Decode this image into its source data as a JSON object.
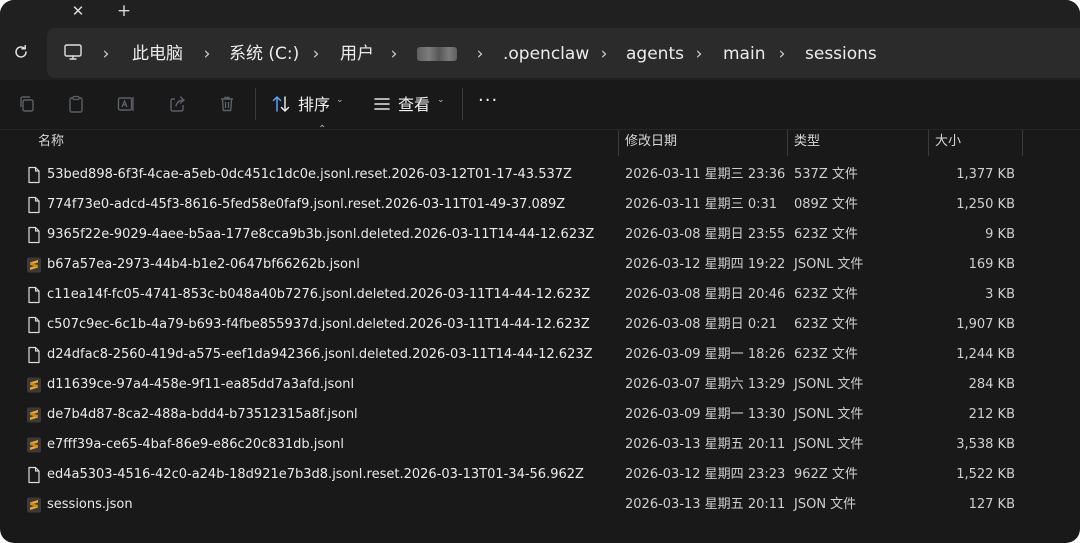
{
  "tabstrip": {
    "close_glyph": "✕",
    "new_glyph": "+"
  },
  "address": {
    "crumbs": [
      "此电脑",
      "系统 (C:)",
      "用户",
      ".openclaw",
      "agents",
      "main",
      "sessions"
    ],
    "separator": "›"
  },
  "toolbar": {
    "sort_label": "排序",
    "view_label": "查看",
    "more_label": "···"
  },
  "columns": {
    "name": "名称",
    "modified": "修改日期",
    "type": "类型",
    "size": "大小"
  },
  "files": [
    {
      "name": "53bed898-6f3f-4cae-a5eb-0dc451c1dc0e.jsonl.reset.2026-03-12T01-17-43.537Z",
      "modified": "2026-03-11 星期三 23:36",
      "type": "537Z 文件",
      "size": "1,377 KB",
      "icon": "file-icon"
    },
    {
      "name": "774f73e0-adcd-45f3-8616-5fed58e0faf9.jsonl.reset.2026-03-11T01-49-37.089Z",
      "modified": "2026-03-11 星期三 0:31",
      "type": "089Z 文件",
      "size": "1,250 KB",
      "icon": "file-icon"
    },
    {
      "name": "9365f22e-9029-4aee-b5aa-177e8cca9b3b.jsonl.deleted.2026-03-11T14-44-12.623Z",
      "modified": "2026-03-08 星期日 23:55",
      "type": "623Z 文件",
      "size": "9 KB",
      "icon": "file-icon"
    },
    {
      "name": "b67a57ea-2973-44b4-b1e2-0647bf66262b.jsonl",
      "modified": "2026-03-12 星期四 19:22",
      "type": "JSONL 文件",
      "size": "169 KB",
      "icon": "sublime-file-icon"
    },
    {
      "name": "c11ea14f-fc05-4741-853c-b048a40b7276.jsonl.deleted.2026-03-11T14-44-12.623Z",
      "modified": "2026-03-08 星期日 20:46",
      "type": "623Z 文件",
      "size": "3 KB",
      "icon": "file-icon"
    },
    {
      "name": "c507c9ec-6c1b-4a79-b693-f4fbe855937d.jsonl.deleted.2026-03-11T14-44-12.623Z",
      "modified": "2026-03-08 星期日 0:21",
      "type": "623Z 文件",
      "size": "1,907 KB",
      "icon": "file-icon"
    },
    {
      "name": "d24dfac8-2560-419d-a575-eef1da942366.jsonl.deleted.2026-03-11T14-44-12.623Z",
      "modified": "2026-03-09 星期一 18:26",
      "type": "623Z 文件",
      "size": "1,244 KB",
      "icon": "file-icon"
    },
    {
      "name": "d11639ce-97a4-458e-9f11-ea85dd7a3afd.jsonl",
      "modified": "2026-03-07 星期六 13:29",
      "type": "JSONL 文件",
      "size": "284 KB",
      "icon": "sublime-file-icon"
    },
    {
      "name": "de7b4d87-8ca2-488a-bdd4-b73512315a8f.jsonl",
      "modified": "2026-03-09 星期一 13:30",
      "type": "JSONL 文件",
      "size": "212 KB",
      "icon": "sublime-file-icon"
    },
    {
      "name": "e7fff39a-ce65-4baf-86e9-e86c20c831db.jsonl",
      "modified": "2026-03-13 星期五 20:11",
      "type": "JSONL 文件",
      "size": "3,538 KB",
      "icon": "sublime-file-icon"
    },
    {
      "name": "ed4a5303-4516-42c0-a24b-18d921e7b3d8.jsonl.reset.2026-03-13T01-34-56.962Z",
      "modified": "2026-03-12 星期四 23:23",
      "type": "962Z 文件",
      "size": "1,522 KB",
      "icon": "file-icon"
    },
    {
      "name": "sessions.json",
      "modified": "2026-03-13 星期五 20:11",
      "type": "JSON 文件",
      "size": "127 KB",
      "icon": "sublime-file-icon"
    }
  ],
  "colors": {
    "window_bg": "#191919",
    "chrome_bg": "#202020",
    "address_bg": "#2b2b2b",
    "sublime_orange": "#f5a623"
  }
}
